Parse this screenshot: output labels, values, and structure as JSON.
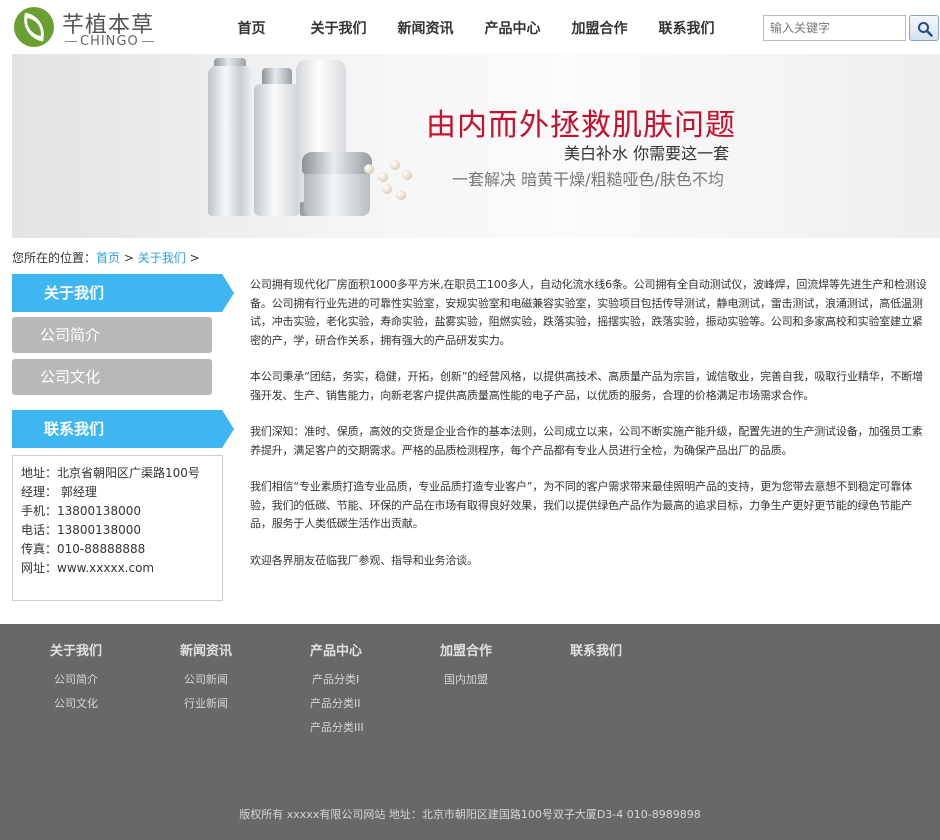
{
  "brand": {
    "name_cn": "芊植本草",
    "name_en": "CHINGO"
  },
  "nav": {
    "items": [
      "首页",
      "关于我们",
      "新闻资讯",
      "产品中心",
      "加盟合作",
      "联系我们"
    ]
  },
  "search": {
    "placeholder": "输入关键字",
    "icon": "search-icon"
  },
  "banner": {
    "title": "由内而外拯救肌肤问题",
    "subtitle": "美白补水  你需要这一套",
    "tagline": "一套解决 暗黄干燥/粗糙哑色/肤色不均"
  },
  "breadcrumb": {
    "prefix": "您所在的位置：",
    "home": "首页",
    "current": "关于我们",
    "separator": ">"
  },
  "sidebar": {
    "about_title": "关于我们",
    "items": [
      "公司简介",
      "公司文化"
    ],
    "contact_title": "联系我们",
    "contact_lines": [
      "地址：北京省朝阳区广渠路100号",
      "经理： 郭经理",
      "手机：13800138000",
      "电话：13800138000",
      "传真：010-88888888",
      "网址：www.xxxxx.com"
    ]
  },
  "content": {
    "paragraphs": [
      "公司拥有现代化厂房面积1000多平方米,在职员工100多人，自动化流水线6条。公司拥有全自动测试仪，波峰焊，回流焊等先进生产和检测设备。公司拥有行业先进的可靠性实验室，安规实验室和电磁兼容实验室，实验项目包括传导测试，静电测试，雷击测试，浪涌测试，高低温测试，冲击实验，老化实验，寿命实验，盐雾实验，阻燃实验，跌落实验，摇摆实验，跌落实验，振动实验等。公司和多家高校和实验室建立紧密的产，学，研合作关系，拥有强大的产品研发实力。",
      "本公司秉承“团结，务实，稳健，开拓，创新”的经营风格，以提供高技术、高质量产品为宗旨，诚信敬业，完善自我，吸取行业精华，不断增强开发、生产、销售能力，向新老客户提供高质量高性能的电子产品，以优质的服务，合理的价格满足市场需求合作。",
      "我们深知：准时、保质，高效的交货是企业合作的基本法则，公司成立以来，公司不断实施产能升级，配置先进的生产测试设备，加强员工素养提升，满足客户的交期需求。严格的品质检测程序，每个产品都有专业人员进行全检，为确保产品出厂的品质。",
      "我们相信“专业素质打造专业品质，专业品质打造专业客户”，为不同的客户需求带来最佳照明产品的支持，更为您带去意想不到稳定可靠体验，我们的低碳、节能、环保的产品在市场有取得良好效果，我们以提供绿色产品作为最高的追求目标，力争生产更好更节能的绿色节能产品，服务于人类低碳生活作出贡献。",
      "欢迎各界朋友莅临我厂参观、指导和业务洽谈。"
    ]
  },
  "footer": {
    "columns": [
      {
        "title": "关于我们",
        "links": [
          "公司简介",
          "公司文化"
        ]
      },
      {
        "title": "新闻资讯",
        "links": [
          "公司新闻",
          "行业新闻"
        ]
      },
      {
        "title": "产品中心",
        "links": [
          "产品分类I",
          "产品分类II",
          "产品分类III"
        ]
      },
      {
        "title": "加盟合作",
        "links": [
          "国内加盟"
        ]
      },
      {
        "title": "联系我们",
        "links": []
      }
    ],
    "copyright": "版权所有 xxxxx有限公司网站 地址：北京市朝阳区建国路100号双子大厦D3-4 010-8989898"
  },
  "colors": {
    "accent": "#3eb6f2",
    "banner_red": "#c8102e",
    "footer_bg": "#686868",
    "link": "#2aa0e6"
  }
}
